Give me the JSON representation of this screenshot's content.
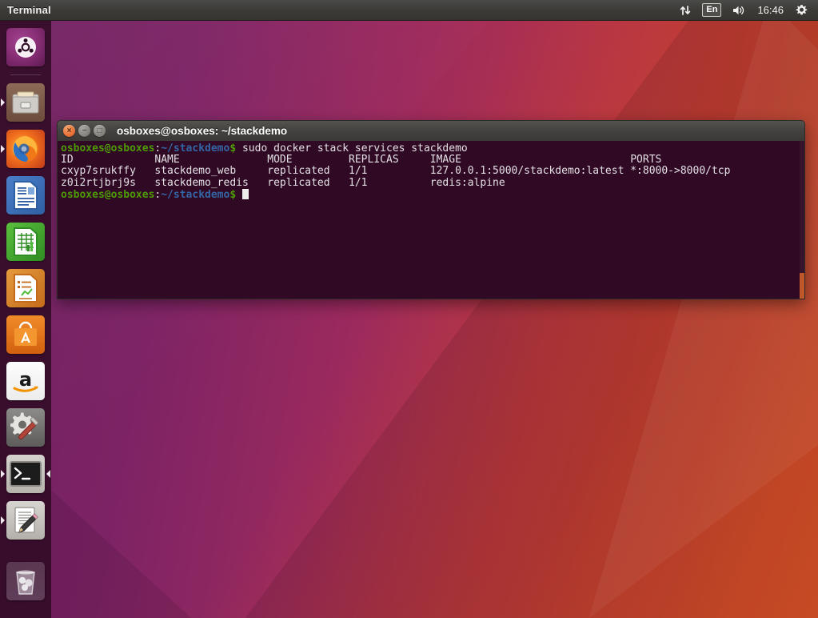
{
  "panel": {
    "app_title": "Terminal",
    "network_icon": "network-updown-icon",
    "keyboard_layout": "En",
    "volume_icon": "volume-icon",
    "clock": "16:46",
    "session_icon": "gear-icon"
  },
  "launcher": {
    "items": [
      {
        "name": "dash-home",
        "label": "Ubuntu Dash Home",
        "icon": "ubuntu-logo-icon",
        "running": false,
        "focused": false
      },
      {
        "name": "files",
        "label": "Files",
        "icon": "file-manager-icon",
        "running": true,
        "focused": false
      },
      {
        "name": "firefox",
        "label": "Firefox Web Browser",
        "icon": "firefox-icon",
        "running": true,
        "focused": false
      },
      {
        "name": "libreoffice-writer",
        "label": "LibreOffice Writer",
        "icon": "document-icon",
        "running": false,
        "focused": false
      },
      {
        "name": "libreoffice-calc",
        "label": "LibreOffice Calc",
        "icon": "spreadsheet-icon",
        "running": false,
        "focused": false
      },
      {
        "name": "libreoffice-impress",
        "label": "LibreOffice Impress",
        "icon": "presentation-icon",
        "running": false,
        "focused": false
      },
      {
        "name": "ubuntu-software",
        "label": "Ubuntu Software",
        "icon": "software-bag-icon",
        "running": false,
        "focused": false
      },
      {
        "name": "amazon",
        "label": "Amazon",
        "icon": "amazon-icon",
        "running": false,
        "focused": false
      },
      {
        "name": "system-settings",
        "label": "System Settings",
        "icon": "gear-wrench-icon",
        "running": false,
        "focused": false
      },
      {
        "name": "terminal",
        "label": "Terminal",
        "icon": "terminal-icon",
        "running": true,
        "focused": true
      },
      {
        "name": "text-editor",
        "label": "Text Editor",
        "icon": "pencil-document-icon",
        "running": true,
        "focused": false
      },
      {
        "name": "trash",
        "label": "Trash",
        "icon": "trash-icon",
        "running": false,
        "focused": false
      }
    ]
  },
  "terminal": {
    "title": "osboxes@osboxes: ~/stackdemo",
    "close_glyph": "×",
    "minimize_glyph": "−",
    "maximize_glyph": "□",
    "prompt": {
      "user_host": "osboxes@osboxes",
      "colon": ":",
      "path": "~/stackdemo",
      "sigil": "$"
    },
    "command": " sudo docker stack services stackdemo",
    "output": {
      "headers": [
        "ID",
        "NAME",
        "MODE",
        "REPLICAS",
        "IMAGE",
        "PORTS"
      ],
      "rows": [
        {
          "id": "cxyp7srukffy",
          "name": "stackdemo_web",
          "mode": "replicated",
          "replicas": "1/1",
          "image": "127.0.0.1:5000/stackdemo:latest",
          "ports": "*:8000->8000/tcp"
        },
        {
          "id": "z0i2rtjbrj9s",
          "name": "stackdemo_redis",
          "mode": "replicated",
          "replicas": "1/1",
          "image": "redis:alpine",
          "ports": ""
        }
      ],
      "header_line": "ID             NAME              MODE         REPLICAS     IMAGE                           PORTS",
      "row_lines": [
        "cxyp7srukffy   stackdemo_web     replicated   1/1          127.0.0.1:5000/stackdemo:latest *:8000->8000/tcp",
        "z0i2rtjbrj9s   stackdemo_redis   replicated   1/1          redis:alpine"
      ]
    }
  },
  "colors": {
    "terminal_background": "#300a24",
    "terminal_foreground": "#e3e0e4",
    "prompt_user_host": "#4e9a06",
    "prompt_path": "#3465a4",
    "panel_background": "#3c3b37",
    "launcher_background": "#2c0a21",
    "close_button": "#e8743a",
    "scrollbar_thumb": "#c0572a",
    "wallpaper_purple": "#6f2060",
    "wallpaper_orange": "#d9522c"
  }
}
